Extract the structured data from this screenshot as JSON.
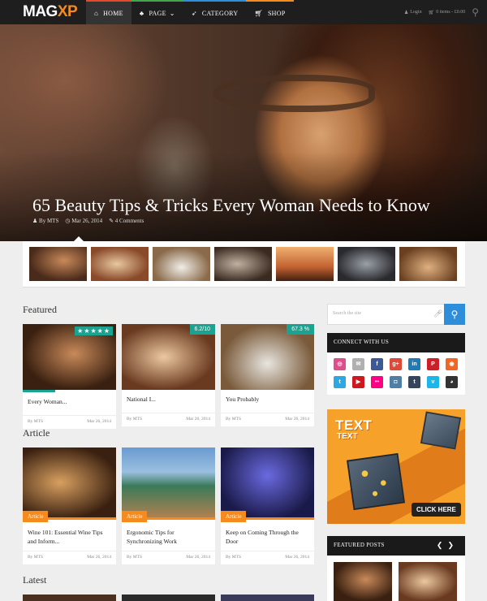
{
  "header": {
    "logo_main": "MAG",
    "logo_accent": "XP",
    "nav": [
      {
        "label": "HOME",
        "icon": "home-icon",
        "accent": "#e44b2a"
      },
      {
        "label": "PAGE",
        "icon": "sitemap-icon",
        "accent": "#3ea84a"
      },
      {
        "label": "CATEGORY",
        "icon": "rocket-icon",
        "accent": "#2f8ed9"
      },
      {
        "label": "SHOP",
        "icon": "cart-icon",
        "accent": "#f58b1f"
      }
    ],
    "login": "Login",
    "cart": "0 items - £0.00"
  },
  "hero": {
    "title": "65 Beauty Tips & Tricks Every Woman Needs to Know",
    "author": "By MTS",
    "date": "Mar 26, 2014",
    "comments": "4 Comments"
  },
  "featured": {
    "heading": "Featured",
    "cards": [
      {
        "title": "Every Woman...",
        "author": "By MTS",
        "date": "Mar 26, 2014",
        "rating": "★★★★★"
      },
      {
        "title": "National I...",
        "author": "By MTS",
        "date": "Mar 26, 2014",
        "rating": "6.2/10"
      },
      {
        "title": "You Probably",
        "author": "By MTS",
        "date": "Mar 26, 2014",
        "rating": "67.3 %"
      }
    ]
  },
  "article": {
    "heading": "Article",
    "cards": [
      {
        "tag": "Article",
        "title": "Wine 101: Essential Wine Tips and Inform...",
        "author": "By MTS",
        "date": "Mar 26, 2014"
      },
      {
        "tag": "Article",
        "title": "Ergonomic Tips for Synchronizing Work",
        "author": "By MTS",
        "date": "Mar 26, 2014"
      },
      {
        "tag": "Article",
        "title": "Keep on Coming Through the Door",
        "author": "By MTS",
        "date": "Mar 26, 2014"
      }
    ]
  },
  "latest": {
    "heading": "Latest"
  },
  "sidebar": {
    "search_placeholder": "Search the site",
    "connect_heading": "CONNECT WITH US",
    "ad_text_big": "TEXT",
    "ad_text_small": "TEXT",
    "ad_button": "CLICK HERE",
    "featured_heading": "FEATURED POSTS",
    "social": [
      {
        "name": "dribbble-icon",
        "glyph": "◎",
        "color": "#e04d8b"
      },
      {
        "name": "mail-icon",
        "glyph": "✉",
        "color": "#b0b0b0"
      },
      {
        "name": "facebook-icon",
        "glyph": "f",
        "color": "#3b5998"
      },
      {
        "name": "google-plus-icon",
        "glyph": "g+",
        "color": "#dc4a38"
      },
      {
        "name": "linkedin-icon",
        "glyph": "in",
        "color": "#1f7bb6"
      },
      {
        "name": "pinterest-icon",
        "glyph": "P",
        "color": "#cb2027"
      },
      {
        "name": "rss-icon",
        "glyph": "◉",
        "color": "#f26522"
      },
      {
        "name": "twitter-icon",
        "glyph": "t",
        "color": "#2ea8e2"
      },
      {
        "name": "youtube-icon",
        "glyph": "▶",
        "color": "#cc181e"
      },
      {
        "name": "flickr-icon",
        "glyph": "••",
        "color": "#ff0084"
      },
      {
        "name": "instagram-icon",
        "glyph": "◘",
        "color": "#517fa4"
      },
      {
        "name": "tumblr-icon",
        "glyph": "t",
        "color": "#35465c"
      },
      {
        "name": "vimeo-icon",
        "glyph": "v",
        "color": "#1ab7ea"
      },
      {
        "name": "github-icon",
        "glyph": "◕",
        "color": "#333333"
      }
    ]
  },
  "colors": {
    "accent_teal": "#1aa391",
    "accent_orange": "#f58b1f",
    "accent_blue": "#2f8ed9"
  }
}
